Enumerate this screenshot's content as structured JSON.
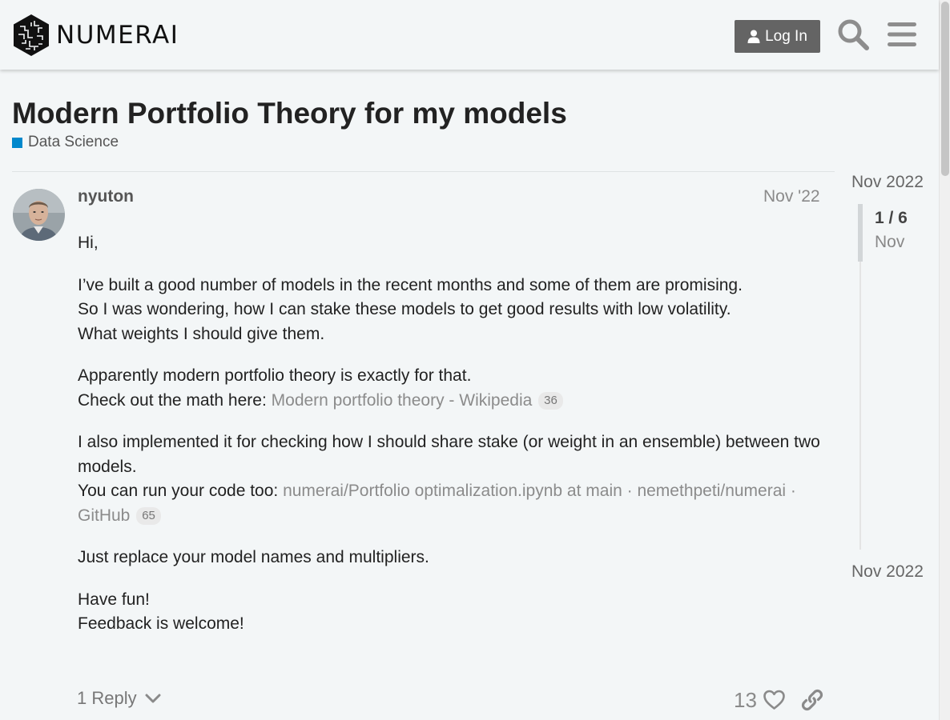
{
  "header": {
    "logo_text": "NUMERAI",
    "login_label": "Log In"
  },
  "topic": {
    "title": "Modern Portfolio Theory for my models",
    "category": "Data Science",
    "category_color": "#0088cc"
  },
  "post": {
    "username": "nyuton",
    "date": "Nov '22",
    "p1": "Hi,",
    "p2_l1": "I’ve built a good number of models in the recent months and some of them are promising.",
    "p2_l2": "So I was wondering, how I can stake these models to get good results with low volatility.",
    "p2_l3": "What weights I should give them.",
    "p3_l1": "Apparently modern portfolio theory is exactly for that.",
    "p3_l2_prefix": "Check out the math here: ",
    "link1_text": "Modern portfolio theory - Wikipedia",
    "link1_clicks": "36",
    "p4_l1": "I also implemented it for checking how I should share stake (or weight in an ensemble) between two models.",
    "p4_l2_prefix": "You can run your code too: ",
    "link2_text": "numerai/Portfolio optimalization.ipynb at main · nemethpeti/numerai · GitHub",
    "link2_clicks": "65",
    "p5": "Just replace your model names and multipliers.",
    "p6_l1": "Have fun!",
    "p6_l2": "Feedback is welcome!",
    "reply_label": "1 Reply",
    "like_count": "13"
  },
  "timeline": {
    "top_date": "Nov 2022",
    "position": "1 / 6",
    "position_sub": "Nov",
    "bottom_date": "Nov 2022"
  }
}
